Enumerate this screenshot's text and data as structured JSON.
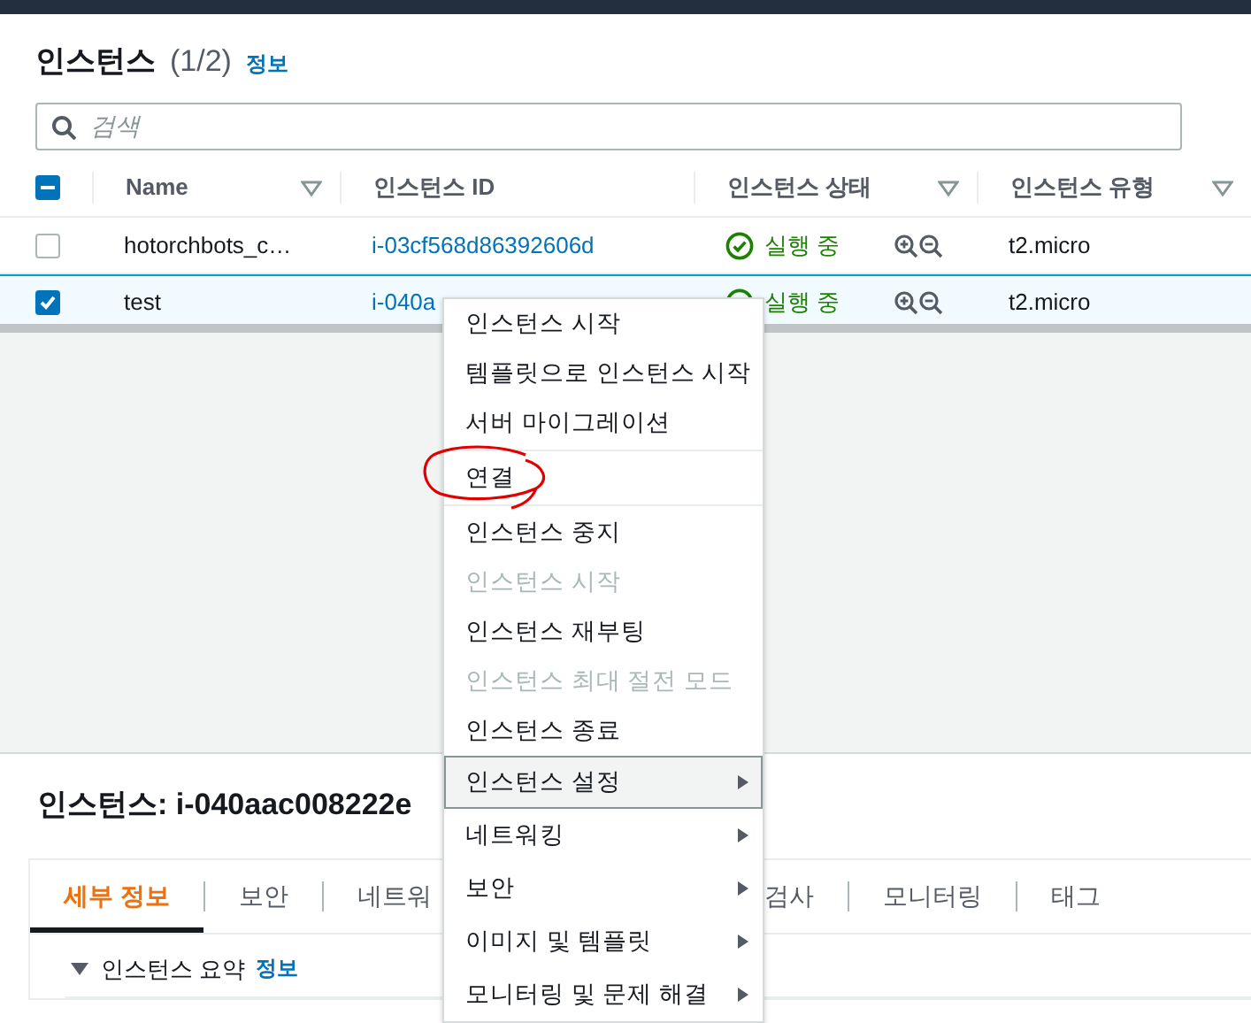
{
  "instances_panel": {
    "title": "인스턴스",
    "count": "(1/2)",
    "info_link": "정보",
    "search": {
      "placeholder": "검색"
    },
    "table": {
      "select_all": {
        "indeterminate": true
      },
      "columns": [
        {
          "label": "Name",
          "filter": true
        },
        {
          "label": "인스턴스 ID",
          "filter": false
        },
        {
          "label": "인스턴스 상태",
          "filter": true
        },
        {
          "label": "인스턴스 유형",
          "filter": true
        }
      ],
      "rows": [
        {
          "checked": false,
          "selected": false,
          "name": "hotorchbots_c…",
          "instance_id": "i-03cf568d86392606d",
          "state": "실행 중",
          "type": "t2.micro"
        },
        {
          "checked": true,
          "selected": true,
          "name": "test",
          "instance_id": "i-040a",
          "state": "실행 중",
          "type": "t2.micro"
        }
      ]
    }
  },
  "context_menu": {
    "items": [
      {
        "label": "인스턴스 시작",
        "disabled": false,
        "submenu": false,
        "highlighted": false,
        "divider_after": false,
        "circled": false
      },
      {
        "label": "템플릿으로 인스턴스 시작",
        "disabled": false,
        "submenu": false,
        "highlighted": false,
        "divider_after": false,
        "circled": false
      },
      {
        "label": "서버 마이그레이션",
        "disabled": false,
        "submenu": false,
        "highlighted": false,
        "divider_after": true,
        "circled": false
      },
      {
        "label": "연결",
        "disabled": false,
        "submenu": false,
        "highlighted": false,
        "divider_after": true,
        "circled": true
      },
      {
        "label": "인스턴스 중지",
        "disabled": false,
        "submenu": false,
        "highlighted": false,
        "divider_after": false,
        "circled": false
      },
      {
        "label": "인스턴스 시작",
        "disabled": true,
        "submenu": false,
        "highlighted": false,
        "divider_after": false,
        "circled": false
      },
      {
        "label": "인스턴스 재부팅",
        "disabled": false,
        "submenu": false,
        "highlighted": false,
        "divider_after": false,
        "circled": false
      },
      {
        "label": "인스턴스 최대 절전 모드",
        "disabled": true,
        "submenu": false,
        "highlighted": false,
        "divider_after": false,
        "circled": false
      },
      {
        "label": "인스턴스 종료",
        "disabled": false,
        "submenu": false,
        "highlighted": false,
        "divider_after": false,
        "circled": false
      },
      {
        "label": "인스턴스 설정",
        "disabled": false,
        "submenu": true,
        "highlighted": true,
        "divider_after": false,
        "circled": false
      },
      {
        "label": "네트워킹",
        "disabled": false,
        "submenu": true,
        "highlighted": false,
        "divider_after": false,
        "circled": false
      },
      {
        "label": "보안",
        "disabled": false,
        "submenu": true,
        "highlighted": false,
        "divider_after": false,
        "circled": false
      },
      {
        "label": "이미지 및 템플릿",
        "disabled": false,
        "submenu": true,
        "highlighted": false,
        "divider_after": false,
        "circled": false
      },
      {
        "label": "모니터링 및 문제 해결",
        "disabled": false,
        "submenu": true,
        "highlighted": false,
        "divider_after": false,
        "circled": false
      }
    ]
  },
  "details_panel": {
    "title": "인스턴스: i-040aac008222e",
    "tabs": [
      {
        "label": "세부 정보",
        "selected": true
      },
      {
        "label": "보안",
        "selected": false
      },
      {
        "label": "네트워",
        "selected": false
      },
      {
        "label": "검사",
        "selected": false
      },
      {
        "label": "모니터링",
        "selected": false
      },
      {
        "label": "태그",
        "selected": false
      }
    ],
    "section": {
      "title": "인스턴스 요약",
      "expanded": true,
      "info_link": "정보"
    }
  }
}
